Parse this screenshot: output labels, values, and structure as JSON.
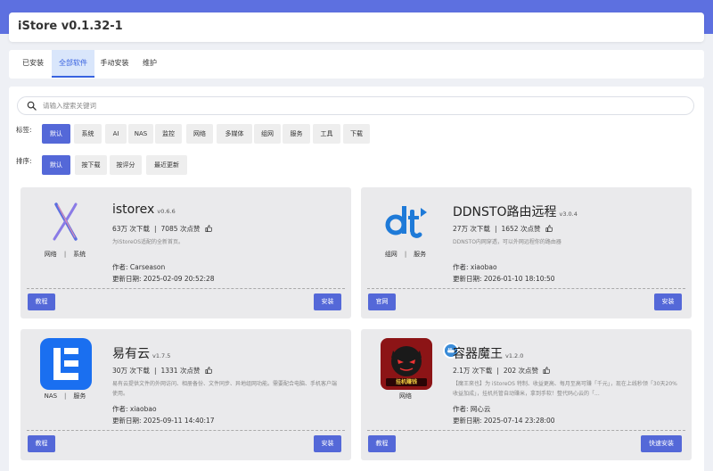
{
  "header": {
    "title": "iStore v0.1.32-1"
  },
  "tabs": [
    {
      "label": "已安装",
      "active": false
    },
    {
      "label": "全部软件",
      "active": true
    },
    {
      "label": "手动安装",
      "active": false
    },
    {
      "label": "维护",
      "active": false
    }
  ],
  "search": {
    "placeholder": "请输入搜索关键词",
    "value": ""
  },
  "filters": {
    "tags_label": "标签:",
    "tags": [
      {
        "label": "默认",
        "active": true
      },
      {
        "label": "系统",
        "active": false
      },
      {
        "label": "AI",
        "active": false
      },
      {
        "label": "NAS",
        "active": false
      },
      {
        "label": "监控",
        "active": false
      },
      {
        "label": "网络",
        "active": false
      },
      {
        "label": "多媒体",
        "active": false
      },
      {
        "label": "组网",
        "active": false
      },
      {
        "label": "服务",
        "active": false
      },
      {
        "label": "工具",
        "active": false
      },
      {
        "label": "下载",
        "active": false
      }
    ],
    "sort_label": "排序:",
    "sorts": [
      {
        "label": "默认",
        "active": true
      },
      {
        "label": "按下载",
        "active": false
      },
      {
        "label": "按评分",
        "active": false
      },
      {
        "label": "最近更新",
        "active": false
      }
    ]
  },
  "apps": [
    {
      "name": "istorex",
      "version": "v0.6.6",
      "downloads": "63万 次下载",
      "likes": "7085 次点赞",
      "description": "为iStoreOS适配的全新首页。",
      "categories": [
        "网络",
        "系统"
      ],
      "author": "作者: Carseason",
      "updated": "更新日期: 2025-02-09 20:52:28",
      "left_button": "教程",
      "right_button": "安装",
      "logo_icon": "istorex-x-icon"
    },
    {
      "name": "DDNSTO路由远程",
      "version": "v3.0.4",
      "downloads": "27万 次下载",
      "likes": "1652 次点赞",
      "description": "DDNSTO内网穿透，可以外网远程你的路由器",
      "categories": [
        "组网",
        "服务"
      ],
      "author": "作者: xiaobao",
      "updated": "更新日期: 2026-01-10 18:10:50",
      "left_button": "官网",
      "right_button": "安装",
      "logo_icon": "ddnsto-dt-icon"
    },
    {
      "name": "易有云",
      "version": "v1.7.5",
      "downloads": "30万 次下载",
      "likes": "1331 次点赞",
      "description": "易有云提供文件的外网访问、相册备份、文件同步、异地组网功能。需要配合电脑、手机客户端使用。",
      "categories": [
        "NAS",
        "服务"
      ],
      "author": "作者: xiaobao",
      "updated": "更新日期: 2025-09-11 14:40:17",
      "left_button": "教程",
      "right_button": "安装",
      "logo_icon": "linkease-e-icon"
    },
    {
      "name": "容器魔王",
      "version": "v1.2.0",
      "downloads": "2.1万 次下载",
      "likes": "202 次点赞",
      "description": "【魔王來也】为 iStoreOS 特制、收益更高、每月至高可赚「千元」，现在上线秒领「30天20%收益加成」，挂机托管自动赚米，拿到手软！整代码心云的「...",
      "categories": [
        "网络"
      ],
      "author": "作者: 网心云",
      "updated": "更新日期: 2025-07-14 23:28:00",
      "left_button": "教程",
      "right_button": "快速安装",
      "logo_text": "挂机赚钱",
      "logo_icon": "container-demon-icon"
    }
  ],
  "colors": {
    "accent": "#5468d8",
    "top_band": "#5d70e0",
    "tab_active_bg": "#d9e6fb",
    "tab_active_text": "#3862e0",
    "card_bg": "#eaeaec"
  }
}
